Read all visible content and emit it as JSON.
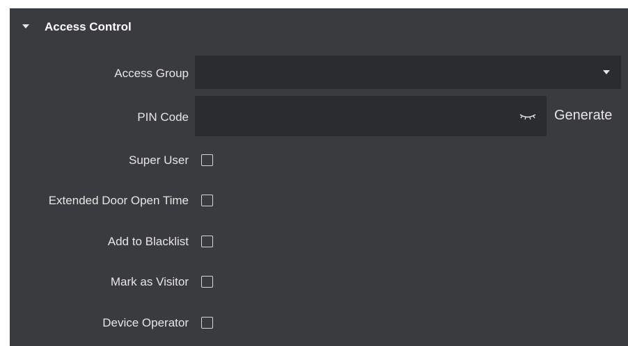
{
  "section": {
    "title": "Access Control",
    "expand_icon": "caret-down-icon"
  },
  "fields": {
    "access_group": {
      "label": "Access Group",
      "value": "",
      "dropdown_icon": "caret-down-icon"
    },
    "pin_code": {
      "label": "PIN Code",
      "value": "",
      "visibility_icon": "eye-closed-icon",
      "generate_label": "Generate"
    },
    "super_user": {
      "label": "Super User",
      "checked": false
    },
    "extended_door_open_time": {
      "label": "Extended Door Open Time",
      "checked": false
    },
    "add_to_blacklist": {
      "label": "Add to Blacklist",
      "checked": false
    },
    "mark_as_visitor": {
      "label": "Mark as Visitor",
      "checked": false
    },
    "device_operator": {
      "label": "Device Operator",
      "checked": false
    }
  },
  "colors": {
    "panel_background": "#3a3b3f",
    "input_background": "#2b2c30",
    "text": "#e6e6e6"
  }
}
